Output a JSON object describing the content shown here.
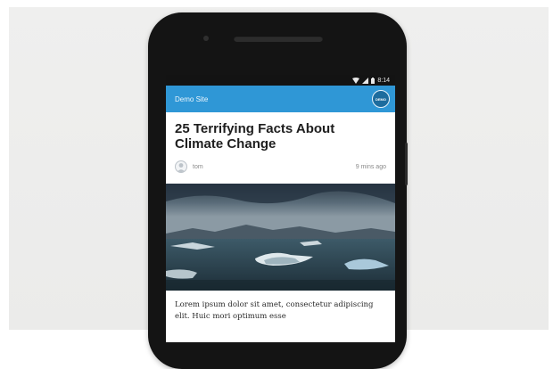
{
  "status_bar": {
    "time": "8:14"
  },
  "app_bar": {
    "site_title": "Demo Site",
    "logo_text": "DEMO"
  },
  "article": {
    "title": "25 Terrifying Facts About Climate Change",
    "author": "tom",
    "posted": "9 mins ago",
    "excerpt": "Lorem ipsum dolor sit amet, consectetur adipiscing elit. Huic mori optimum esse"
  },
  "colors": {
    "accent": "#2f97d6",
    "phone_body": "#141414",
    "background": "#ececeb"
  }
}
